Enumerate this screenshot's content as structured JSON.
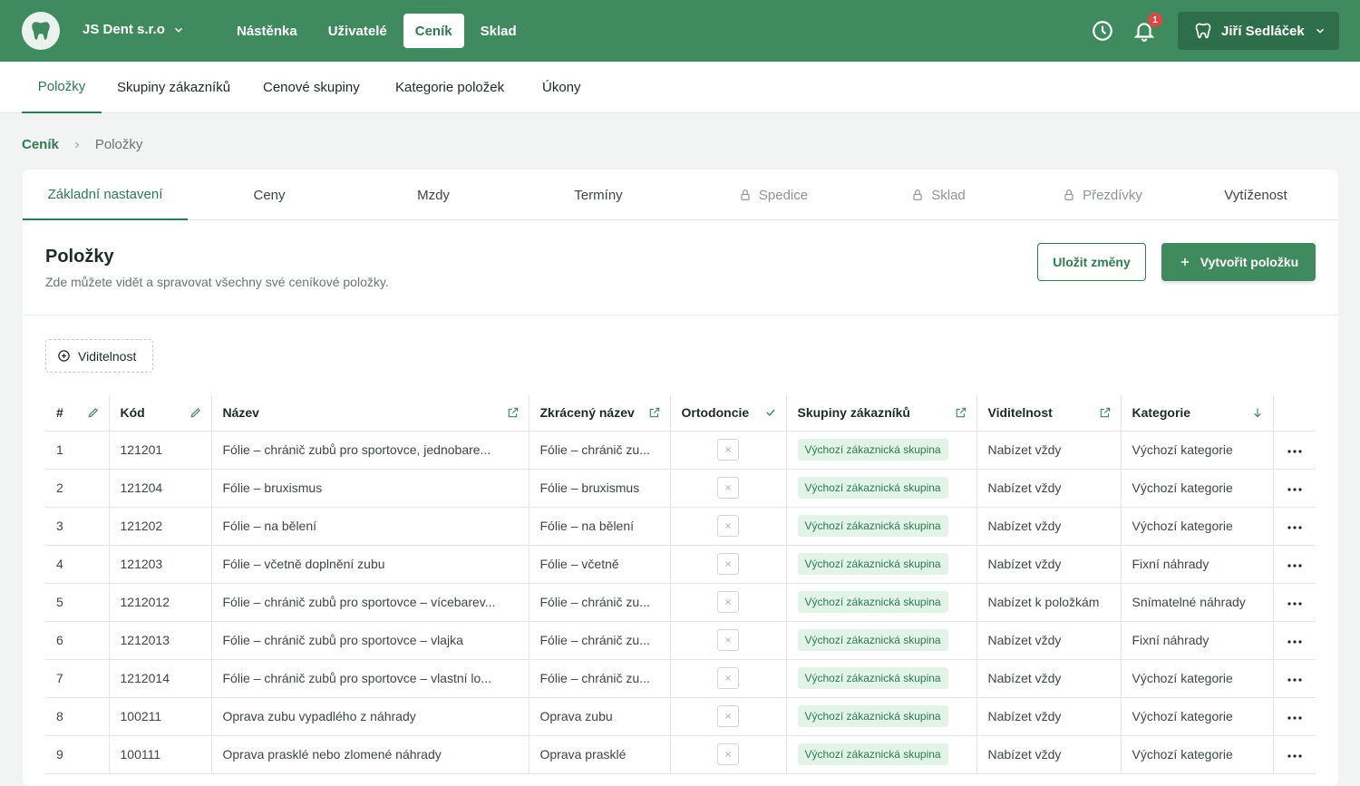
{
  "header": {
    "company": "JS Dent s.r.o",
    "nav": [
      "Nástěnka",
      "Uživatelé",
      "Ceník",
      "Sklad"
    ],
    "notification_count": "1",
    "user": "Jiří Sedláček"
  },
  "subnav": [
    "Položky",
    "Skupiny zákazníků",
    "Cenové skupiny",
    "Kategorie položek",
    "Úkony"
  ],
  "breadcrumb": [
    "Ceník",
    "Položky"
  ],
  "tabs": [
    "Základní nastavení",
    "Ceny",
    "Mzdy",
    "Termíny",
    "Spedice",
    "Sklad",
    "Přezdívky",
    "Vytíženost"
  ],
  "section": {
    "title": "Položky",
    "subtitle": "Zde můžete vidět a spravovat všechny své ceníkové položky.",
    "save_label": "Uložit změny",
    "create_label": "Vytvořit položku",
    "filter_label": "Viditelnost"
  },
  "table": {
    "columns": [
      "#",
      "Kód",
      "Název",
      "Zkrácený název",
      "Ortodoncie",
      "Skupiny zákazníků",
      "Viditelnost",
      "Kategorie"
    ],
    "rows": [
      [
        "1",
        "121201",
        "Fólie – chránič zubů pro sportovce, jednobare...",
        "Fólie – chránič zu...",
        "Výchozí zákaznická skupina",
        "Nabízet vždy",
        "Výchozí kategorie"
      ],
      [
        "2",
        "121204",
        "Fólie – bruxismus",
        "Fólie – bruxismus",
        "Výchozí zákaznická skupina",
        "Nabízet vždy",
        "Výchozí kategorie"
      ],
      [
        "3",
        "121202",
        "Fólie – na bělení",
        "Fólie – na bělení",
        "Výchozí zákaznická skupina",
        "Nabízet vždy",
        "Výchozí kategorie"
      ],
      [
        "4",
        "121203",
        "Fólie – včetně doplnění zubu",
        "Fólie – včetně",
        "Výchozí zákaznická skupina",
        "Nabízet vždy",
        "Fixní náhrady"
      ],
      [
        "5",
        "1212012",
        "Fólie – chránič zubů pro sportovce – vícebarev...",
        "Fólie – chránič zu...",
        "Výchozí zákaznická skupina",
        "Nabízet k položkám",
        "Snímatelné náhrady"
      ],
      [
        "6",
        "1212013",
        "Fólie – chránič zubů pro sportovce – vlajka",
        "Fólie – chránič zu...",
        "Výchozí zákaznická skupina",
        "Nabízet vždy",
        "Fixní náhrady"
      ],
      [
        "7",
        "1212014",
        "Fólie – chránič zubů pro sportovce – vlastní lo...",
        "Fólie – chránič zu...",
        "Výchozí zákaznická skupina",
        "Nabízet vždy",
        "Výchozí kategorie"
      ],
      [
        "8",
        "100211",
        "Oprava zubu vypadlého z náhrady",
        "Oprava zubu",
        "Výchozí zákaznická skupina",
        "Nabízet vždy",
        "Výchozí kategorie"
      ],
      [
        "9",
        "100111",
        "Oprava prasklé nebo zlomené náhrady",
        "Oprava prasklé",
        "Výchozí zákaznická skupina",
        "Nabízet vždy",
        "Výchozí kategorie"
      ]
    ],
    "row_menu_icon": "more-horizontal-icon"
  },
  "colors": {
    "brand": "#3f8a5f",
    "brand_dark": "#2f6e4b",
    "accent_text": "#2f7a50",
    "badge": "#e04646"
  }
}
